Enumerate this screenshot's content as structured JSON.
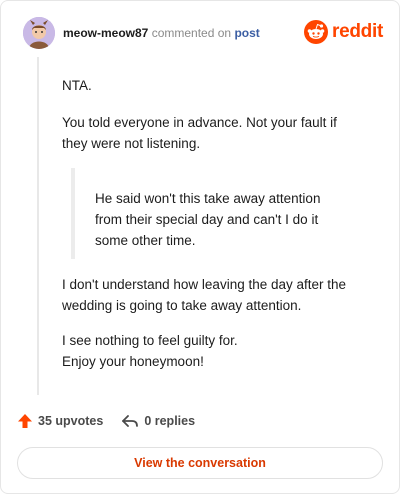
{
  "header": {
    "username": "meow-meow87",
    "action_text": "commented on",
    "post_link": "post",
    "brand": "reddit"
  },
  "comment": {
    "paragraphs": [
      "NTA.",
      "You told everyone in advance. Not your fault if they were not listening.",
      "I don't understand how leaving the day after the wedding is going to take away attention.",
      "I see nothing to feel guilty for. Enjoy your honeymoon!"
    ],
    "quote": "He said won't this take away attention from their special day and can't I do it some other time."
  },
  "actions": {
    "upvotes": "35 upvotes",
    "replies": "0 replies"
  },
  "cta": {
    "label": "View the conversation"
  },
  "colors": {
    "brand": "#ff4500",
    "link": "#3b5ea3",
    "cta_text": "#d93900"
  },
  "icons": {
    "avatar": "avatar",
    "brand": "reddit-logo-icon",
    "upvote": "upvote-arrow-icon",
    "reply": "reply-arrow-icon"
  }
}
